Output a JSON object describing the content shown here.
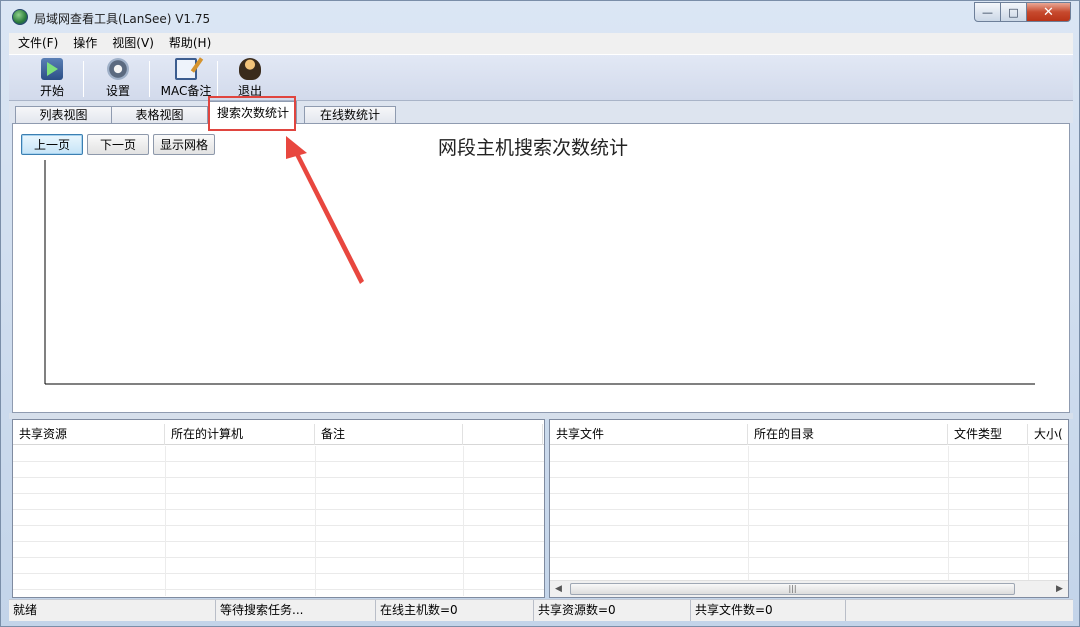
{
  "window": {
    "title": "局域网查看工具(LanSee) V1.75"
  },
  "menu": [
    "文件(F)",
    "操作",
    "视图(V)",
    "帮助(H)"
  ],
  "toolbar": {
    "start": "开始",
    "settings": "设置",
    "mac_note": "MAC备注",
    "exit": "退出"
  },
  "tabs": [
    "列表视图",
    "表格视图",
    "搜索次数统计",
    "在线数统计"
  ],
  "active_tab": "搜索次数统计",
  "chart": {
    "title": "网段主机搜索次数统计",
    "prev_page": "上一页",
    "next_page": "下一页",
    "show_grid": "显示网格"
  },
  "chart_data": {
    "type": "bar",
    "title": "网段主机搜索次数统计",
    "categories": [],
    "values": []
  },
  "shares_list": {
    "columns": [
      "共享资源",
      "所在的计算机",
      "备注",
      ""
    ]
  },
  "files_list": {
    "columns": [
      "共享文件",
      "所在的目录",
      "文件类型",
      "大小("
    ]
  },
  "statusbar": [
    "就绪",
    "等待搜索任务...",
    "在线主机数=0",
    "共享资源数=0",
    "共享文件数=0",
    ""
  ],
  "colors": {
    "annotation": "#e0453f",
    "accent": "#3c7fb1"
  },
  "icons": {
    "start": "start-icon",
    "settings": "gear-icon",
    "mac_note": "note-icon",
    "exit": "exit-icon",
    "app": "app-globe-icon"
  }
}
